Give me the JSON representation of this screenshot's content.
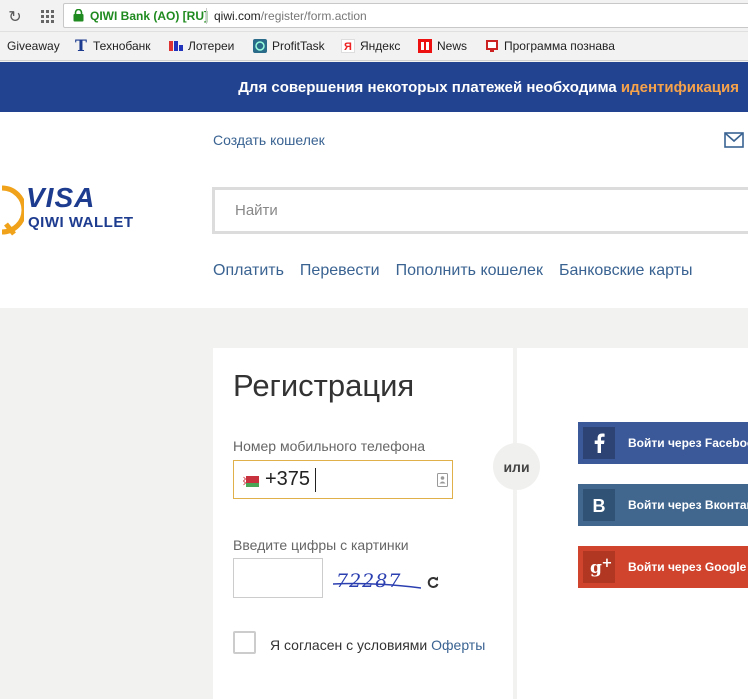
{
  "browser": {
    "ev_label": "QIWI Bank (AO) [RU]",
    "url_domain": "qiwi.com",
    "url_path": "/register/form.action"
  },
  "bookmarks": [
    {
      "label": "Giveaway",
      "icon": "giveaway-icon"
    },
    {
      "label": "Технобанк",
      "icon": "tehnobank-icon"
    },
    {
      "label": "Лотереи",
      "icon": "lottery-icon"
    },
    {
      "label": "ProfitTask",
      "icon": "profittask-icon"
    },
    {
      "label": "Яндекс",
      "icon": "yandex-icon"
    },
    {
      "label": "News",
      "icon": "news-icon"
    },
    {
      "label": "Программа познава",
      "icon": "program-icon"
    }
  ],
  "banner": {
    "text": "Для совершения некоторых платежей необходима ",
    "highlight": "идентификация"
  },
  "header": {
    "create_wallet": "Создать кошелек",
    "logo_top": "VISA",
    "logo_bottom": "QIWI WALLET",
    "search_placeholder": "Найти",
    "nav": [
      "Оплатить",
      "Перевести",
      "Пополнить кошелек",
      "Банковские карты"
    ]
  },
  "registration": {
    "title": "Регистрация",
    "phone_label": "Номер мобильного телефона",
    "phone_value": "+375",
    "captcha_label": "Введите цифры с картинки",
    "captcha_text": "72287",
    "agree_text": "Я согласен с условиями ",
    "agree_link": "Оферты"
  },
  "or_label": "или",
  "social": [
    {
      "label": "Войти через Facebook",
      "color": "#3b5998",
      "icon": "facebook-icon"
    },
    {
      "label": "Войти через Вконтакте",
      "color": "#41678f",
      "icon": "vkontakte-icon"
    },
    {
      "label": "Войти через Google",
      "color": "#d0442e",
      "icon": "google-plus-icon"
    }
  ],
  "colors": {
    "banner": "#22438f",
    "banner_highlight": "#f5a24b",
    "link": "#3a6392",
    "focus_border": "#e0b04a"
  }
}
